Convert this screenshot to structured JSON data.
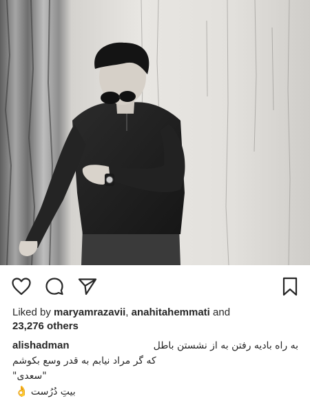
{
  "post": {
    "photo": {
      "alt_icon": "photo-image"
    },
    "actions": {
      "like_icon": "heart-icon",
      "comment_icon": "comment-bubble-icon",
      "share_icon": "paper-plane-icon",
      "save_icon": "bookmark-icon"
    },
    "likes": {
      "prefix": "Liked by ",
      "user1": "maryamrazavii",
      "separator": ", ",
      "user2": "anahitahemmati",
      "conjunction": " and",
      "others": "23,276 others"
    },
    "caption": {
      "owner": "alishadman",
      "line1": "به راه بادیه رفتن به از نشستن باطل",
      "line2": "که گر مراد نیابم به قدر وسع بکوشم",
      "line3": "\"سعدی\"",
      "line4": "بیتِ دُرُست",
      "emoji": "👌"
    },
    "colors": {
      "text": "#262626",
      "background": "#ffffff"
    }
  }
}
